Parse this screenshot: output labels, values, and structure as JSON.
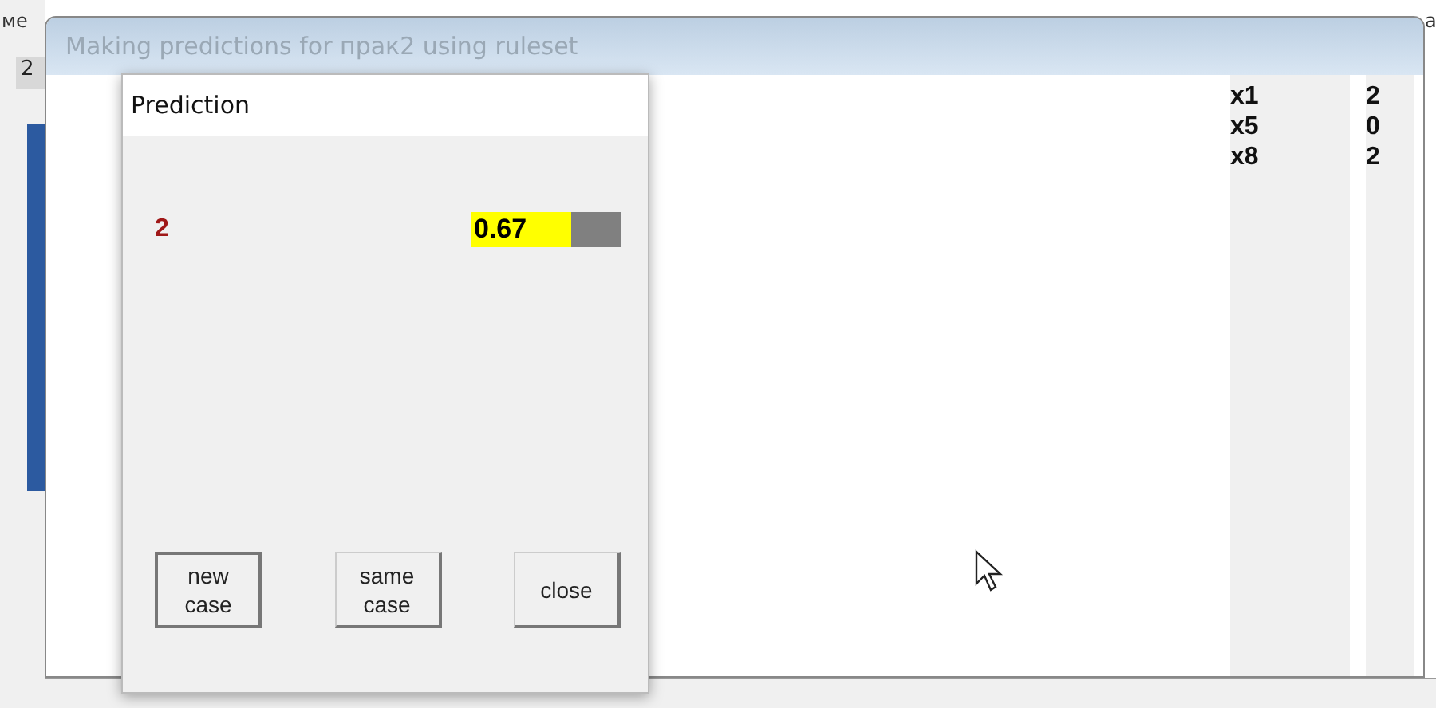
{
  "background_app": {
    "menu_fragment": "ме",
    "cell_fragment": "2",
    "edge_fragment": "a"
  },
  "window": {
    "title": "Making predictions for прак2 using ruleset"
  },
  "attributes": [
    {
      "name": "x1",
      "value": "2"
    },
    {
      "name": "x5",
      "value": "0"
    },
    {
      "name": "x8",
      "value": "2"
    }
  ],
  "dialog": {
    "title": "Prediction",
    "prediction": {
      "class": "2",
      "reading": "0.67",
      "level": 0.67
    },
    "buttons": [
      {
        "label": "new case",
        "default": true
      },
      {
        "label": "same case",
        "default": false
      },
      {
        "label": "close",
        "default": false
      }
    ]
  }
}
